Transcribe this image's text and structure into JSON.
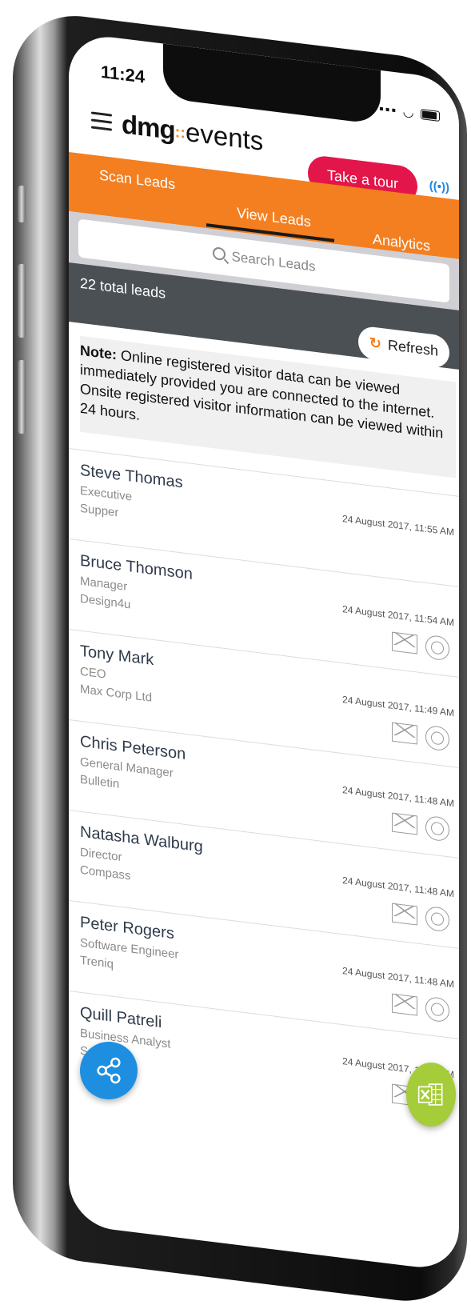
{
  "status": {
    "time": "11:24"
  },
  "header": {
    "logo_main": "dmg",
    "logo_sub": "events",
    "tour_label": "Take a tour",
    "beacon_glyph": "((•))"
  },
  "tabs": [
    {
      "label": "Scan Leads"
    },
    {
      "label": "View Leads",
      "active": true
    },
    {
      "label": "Analytics"
    }
  ],
  "search": {
    "placeholder": "Search Leads"
  },
  "summary": {
    "count_label": "22 total leads",
    "refresh_label": "Refresh"
  },
  "note": {
    "prefix": "Note:",
    "text": " Online registered visitor data can be viewed immediately provided you are connected to the internet. Onsite registered visitor information can be viewed within 24 hours."
  },
  "leads": [
    {
      "name": "Steve Thomas",
      "title": "Executive",
      "company": "Supper",
      "date": "24 August 2017, 11:55 AM"
    },
    {
      "name": "Bruce Thomson",
      "title": "Manager",
      "company": "Design4u",
      "date": "24 August 2017, 11:54 AM"
    },
    {
      "name": "Tony Mark",
      "title": "CEO",
      "company": "Max Corp Ltd",
      "date": "24 August 2017, 11:49 AM"
    },
    {
      "name": "Chris Peterson",
      "title": "General Manager",
      "company": "Bulletin",
      "date": "24 August 2017, 11:48 AM"
    },
    {
      "name": "Natasha Walburg",
      "title": "Director",
      "company": "Compass",
      "date": "24 August 2017, 11:48 AM"
    },
    {
      "name": "Peter Rogers",
      "title": "Software Engineer",
      "company": "Treniq",
      "date": "24 August 2017, 11:48 AM"
    },
    {
      "name": "Quill Patreli",
      "title": "Business Analyst",
      "company": "Solutions",
      "date": "24 August 2017, 11:47 AM"
    }
  ],
  "colors": {
    "brand_orange": "#f37f20",
    "tour_red": "#e2164a",
    "share_blue": "#1e8fe0",
    "excel_green": "#a5cd39"
  },
  "icons": {
    "share": "share-icon",
    "excel": "excel-icon",
    "mail": "mail-icon",
    "view": "eye-icon"
  }
}
